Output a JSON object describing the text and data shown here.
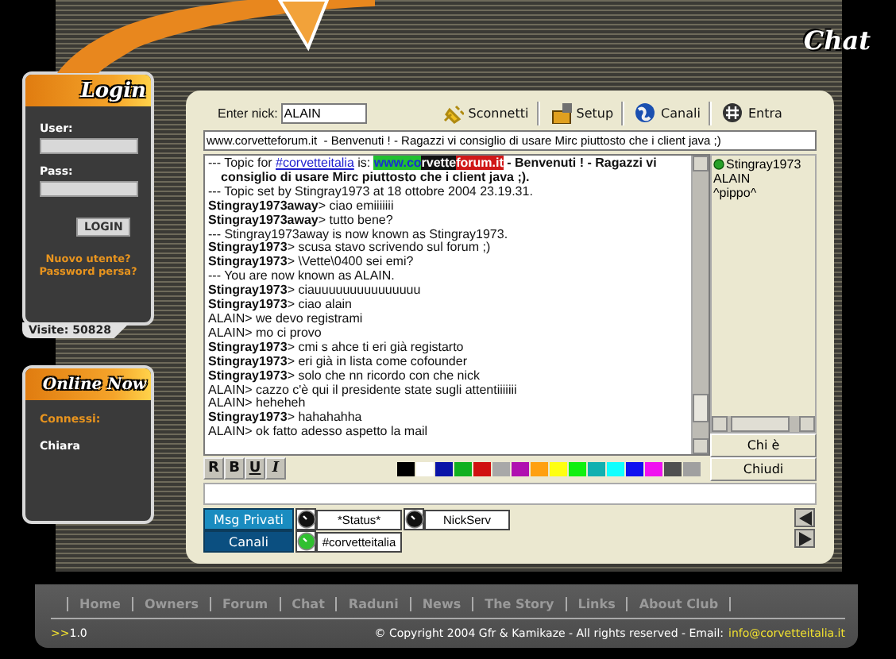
{
  "login": {
    "title": "Login",
    "user_label": "User:",
    "pass_label": "Pass:",
    "button": "LOGIN",
    "links": [
      "Nuovo utente?",
      "Password persa?"
    ],
    "visits": "Visite: 50828"
  },
  "online": {
    "title": "Online Now",
    "label": "Connessi:",
    "users": [
      "Chiara"
    ]
  },
  "page_title": "Chat",
  "toolbar": {
    "nick_label": "Enter nick:",
    "nick_value": "ALAIN",
    "buttons": [
      {
        "kind": "plug",
        "label": "Sconnetti"
      },
      {
        "kind": "setup",
        "label": "Setup"
      },
      {
        "kind": "globe",
        "label": "Canali"
      },
      {
        "kind": "hash",
        "label": "Entra"
      }
    ]
  },
  "topic_field": "www.corvetteforum.it  - Benvenuti ! - Ragazzi vi consiglio di usare Mirc piuttosto che i client java ;)",
  "log": [
    {
      "kind": "topic",
      "prefix": "--- Topic for",
      "channel": "#corvetteitalia",
      "is": "is:",
      "url_parts": [
        {
          "text": "www.co",
          "color": "#22c030"
        },
        {
          "text": "rvette",
          "color": "#111111"
        },
        {
          "text": "forum.it",
          "color": "#d01818"
        }
      ],
      "text": "- Benvenuti ! - Ragazzi vi consiglio di usare Mirc piuttosto che i client java ;)."
    },
    {
      "kind": "info",
      "text": "--- Topic set by Stingray1973 at 18 ottobre 2004 23.19.31."
    },
    {
      "kind": "msg",
      "nick": "Stingray1973away",
      "text": "> ciao emiiiiiii"
    },
    {
      "kind": "msg",
      "nick": "Stingray1973away",
      "text": "> tutto bene?"
    },
    {
      "kind": "info",
      "text": "--- Stingray1973away is now known as Stingray1973."
    },
    {
      "kind": "msg",
      "nick": "Stingray1973",
      "text": "> scusa stavo scrivendo sul forum ;)"
    },
    {
      "kind": "msg",
      "nick": "Stingray1973",
      "text": "> \\Vette\\0400 sei emi?"
    },
    {
      "kind": "info",
      "text": "--- You are now known as ALAIN."
    },
    {
      "kind": "msg",
      "nick": "Stingray1973",
      "text": "> ciauuuuuuuuuuuuuuu"
    },
    {
      "kind": "msg",
      "nick": "Stingray1973",
      "text": "> ciao alain"
    },
    {
      "kind": "self",
      "text": "ALAIN> we devo registrami"
    },
    {
      "kind": "self",
      "text": "ALAIN> mo ci provo"
    },
    {
      "kind": "msg",
      "nick": "Stingray1973",
      "text": "> cmi s ahce ti eri già registarto"
    },
    {
      "kind": "msg",
      "nick": "Stingray1973",
      "text": "> eri già in lista come cofounder"
    },
    {
      "kind": "msg",
      "nick": "Stingray1973",
      "text": "> solo che nn ricordo con che nick"
    },
    {
      "kind": "self",
      "text": "ALAIN> cazzo c'è qui il presidente state sugli attentiiiiiii"
    },
    {
      "kind": "self",
      "text": "ALAIN> heheheh"
    },
    {
      "kind": "msg",
      "nick": "Stingray1973",
      "text": "> hahahahha"
    },
    {
      "kind": "self",
      "text": "ALAIN> ok fatto adesso aspetto la mail"
    }
  ],
  "users": [
    {
      "name": "Stingray1973",
      "op": true
    },
    {
      "name": "ALAIN",
      "op": false
    },
    {
      "name": "^pippo^",
      "op": false
    }
  ],
  "side_buttons": [
    "Chi è",
    "Chiudi"
  ],
  "format_buttons": [
    {
      "kind": "reverse",
      "label": "R"
    },
    {
      "kind": "bold",
      "label": "B"
    },
    {
      "kind": "underline",
      "label": "U"
    },
    {
      "kind": "italic",
      "label": "I"
    }
  ],
  "palette": [
    {
      "color": "#000000"
    },
    {
      "color": "#ffffff"
    },
    {
      "color": "#0a14a8"
    },
    {
      "color": "#10b020"
    },
    {
      "color": "#d01010"
    },
    {
      "color": "#a8a8a8"
    },
    {
      "color": "#b010b0"
    },
    {
      "color": "#ffa010"
    },
    {
      "color": "#ffff10"
    },
    {
      "color": "#10f010"
    },
    {
      "color": "#10b0b0"
    },
    {
      "color": "#10ffff"
    },
    {
      "color": "#1010f0"
    },
    {
      "color": "#f010f0"
    },
    {
      "color": "#505050"
    },
    {
      "color": "#a0a0a0"
    }
  ],
  "window_groups": [
    {
      "label": "Msg Privati",
      "selected": false,
      "windows": [
        {
          "label": "*Status*",
          "active": false
        },
        {
          "label": "NickServ",
          "active": false
        }
      ]
    },
    {
      "label": "Canali",
      "selected": true,
      "windows": [
        {
          "label": "#corvetteitalia",
          "active": true
        }
      ]
    }
  ],
  "footer": {
    "nav": [
      "Home",
      "Owners",
      "Forum",
      "Chat",
      "Raduni",
      "News",
      "The Story",
      "Links",
      "About Club"
    ],
    "version_mark": ">>",
    "version": "1.0",
    "copyright": "© Copyright 2004 Gfr & Kamikaze - All rights reserved - Email:",
    "email": "info@corvetteitalia.it"
  }
}
